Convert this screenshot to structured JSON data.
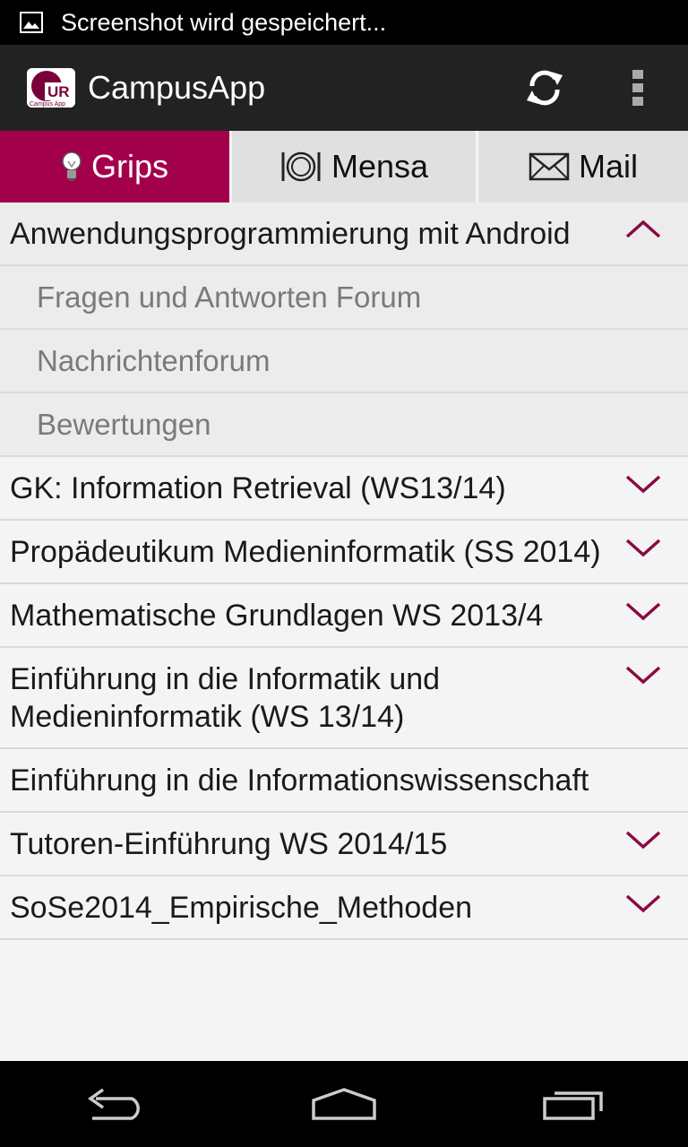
{
  "status_bar": {
    "text": "Screenshot wird gespeichert..."
  },
  "action_bar": {
    "title": "CampusApp",
    "logo_text": "UR",
    "logo_subtext": "Campus App"
  },
  "tabs": [
    {
      "label": "Grips",
      "icon": "lightbulb-icon",
      "active": true
    },
    {
      "label": "Mensa",
      "icon": "plate-cutlery-icon",
      "active": false
    },
    {
      "label": "Mail",
      "icon": "envelope-icon",
      "active": false
    }
  ],
  "courses": [
    {
      "title": "Anwendungsprogrammierung mit Android",
      "expanded": true,
      "children": [
        "Fragen und Antworten Forum",
        "Nachrichtenforum",
        "Bewertungen"
      ]
    },
    {
      "title": "GK: Information Retrieval (WS13/14)",
      "expanded": false
    },
    {
      "title": "Propädeutikum Medieninformatik (SS 2014)",
      "expanded": false
    },
    {
      "title": "Mathematische Grundlagen WS 2013/4",
      "expanded": false
    },
    {
      "title": "Einführung in die Informatik und Medieninformatik (WS 13/14)",
      "expanded": false
    },
    {
      "title": "Einführung in die Informationswissenschaft",
      "expanded": null
    },
    {
      "title": "Tutoren-Einführung WS 2014/15",
      "expanded": false
    },
    {
      "title": "SoSe2014_Empirische_Methoden",
      "expanded": false
    }
  ],
  "colors": {
    "accent": "#a3004c",
    "action_bar": "#222222",
    "list_bg": "#f4f4f4"
  }
}
